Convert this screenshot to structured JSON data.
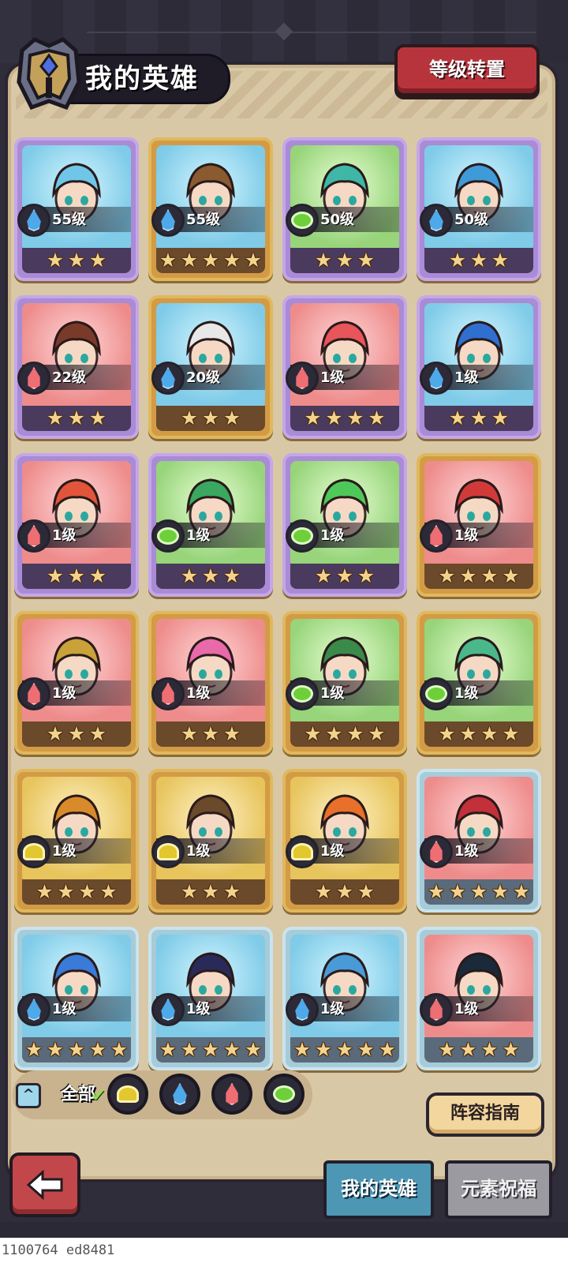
{
  "header": {
    "title": "我的英雄",
    "level_reset_label": "等级转置"
  },
  "heroes": [
    {
      "level": "55级",
      "element": "water",
      "stars": "★★★",
      "rarity": "purple",
      "hair": "#6fc6e8"
    },
    {
      "level": "55级",
      "element": "water",
      "stars": "★★★★★",
      "rarity": "gold",
      "hair": "#8a5a30"
    },
    {
      "level": "50级",
      "element": "wood",
      "stars": "★★★",
      "rarity": "purple",
      "hair": "#3fb7a6"
    },
    {
      "level": "50级",
      "element": "water",
      "stars": "★★★",
      "rarity": "purple",
      "hair": "#3f9ad8"
    },
    {
      "level": "22级",
      "element": "fire",
      "stars": "★★★",
      "rarity": "purple",
      "hair": "#7a3a2a"
    },
    {
      "level": "20级",
      "element": "water",
      "stars": "★★★",
      "rarity": "gold",
      "hair": "#e8e8e8"
    },
    {
      "level": "1级",
      "element": "fire",
      "stars": "★★★★",
      "rarity": "purple",
      "hair": "#e8555a"
    },
    {
      "level": "1级",
      "element": "water",
      "stars": "★★★",
      "rarity": "purple",
      "hair": "#2f6fd0"
    },
    {
      "level": "1级",
      "element": "fire",
      "stars": "★★★",
      "rarity": "purple",
      "hair": "#e2553a"
    },
    {
      "level": "1级",
      "element": "wood",
      "stars": "★★★",
      "rarity": "purple",
      "hair": "#3aa860"
    },
    {
      "level": "1级",
      "element": "wood",
      "stars": "★★★",
      "rarity": "purple",
      "hair": "#4fc85a"
    },
    {
      "level": "1级",
      "element": "fire",
      "stars": "★★★★",
      "rarity": "gold",
      "hair": "#d23a3a"
    },
    {
      "level": "1级",
      "element": "fire",
      "stars": "★★★",
      "rarity": "gold",
      "hair": "#c9a23a"
    },
    {
      "level": "1级",
      "element": "fire",
      "stars": "★★★",
      "rarity": "gold",
      "hair": "#e86aa8"
    },
    {
      "level": "1级",
      "element": "wood",
      "stars": "★★★★",
      "rarity": "gold",
      "hair": "#3a8a4a"
    },
    {
      "level": "1级",
      "element": "wood",
      "stars": "★★★★",
      "rarity": "gold",
      "hair": "#4ab88a"
    },
    {
      "level": "1级",
      "element": "earth",
      "stars": "★★★★",
      "rarity": "gold",
      "hair": "#d98a2a"
    },
    {
      "level": "1级",
      "element": "earth",
      "stars": "★★★",
      "rarity": "gold",
      "hair": "#6a4a2a"
    },
    {
      "level": "1级",
      "element": "earth",
      "stars": "★★★",
      "rarity": "gold",
      "hair": "#e8702a"
    },
    {
      "level": "1级",
      "element": "fire",
      "stars": "★★★★★",
      "rarity": "blue",
      "hair": "#c2303a"
    },
    {
      "level": "1级",
      "element": "water",
      "stars": "★★★★★",
      "rarity": "blue",
      "hair": "#3a7ad8"
    },
    {
      "level": "1级",
      "element": "water",
      "stars": "★★★★★",
      "rarity": "blue",
      "hair": "#2a2a5a"
    },
    {
      "level": "1级",
      "element": "water",
      "stars": "★★★★★",
      "rarity": "blue",
      "hair": "#4a9ad8"
    },
    {
      "level": "1级",
      "element": "fire",
      "stars": "★★★★",
      "rarity": "blue",
      "hair": "#1a2a3a"
    }
  ],
  "filter": {
    "collapse_icon": "^",
    "all_label": "全部",
    "check_mark": "✔",
    "elements": [
      "earth",
      "water",
      "fire",
      "wood"
    ]
  },
  "lineup_guide_label": "阵容指南",
  "tabs": {
    "my_heroes": "我的英雄",
    "element_blessing": "元素祝福"
  },
  "footer_id": "1100764 ed8481",
  "colors": {
    "water": "#4ea9ea",
    "fire": "#ee6e74",
    "wood": "#6fcf3a",
    "earth": "#e2c72e"
  }
}
